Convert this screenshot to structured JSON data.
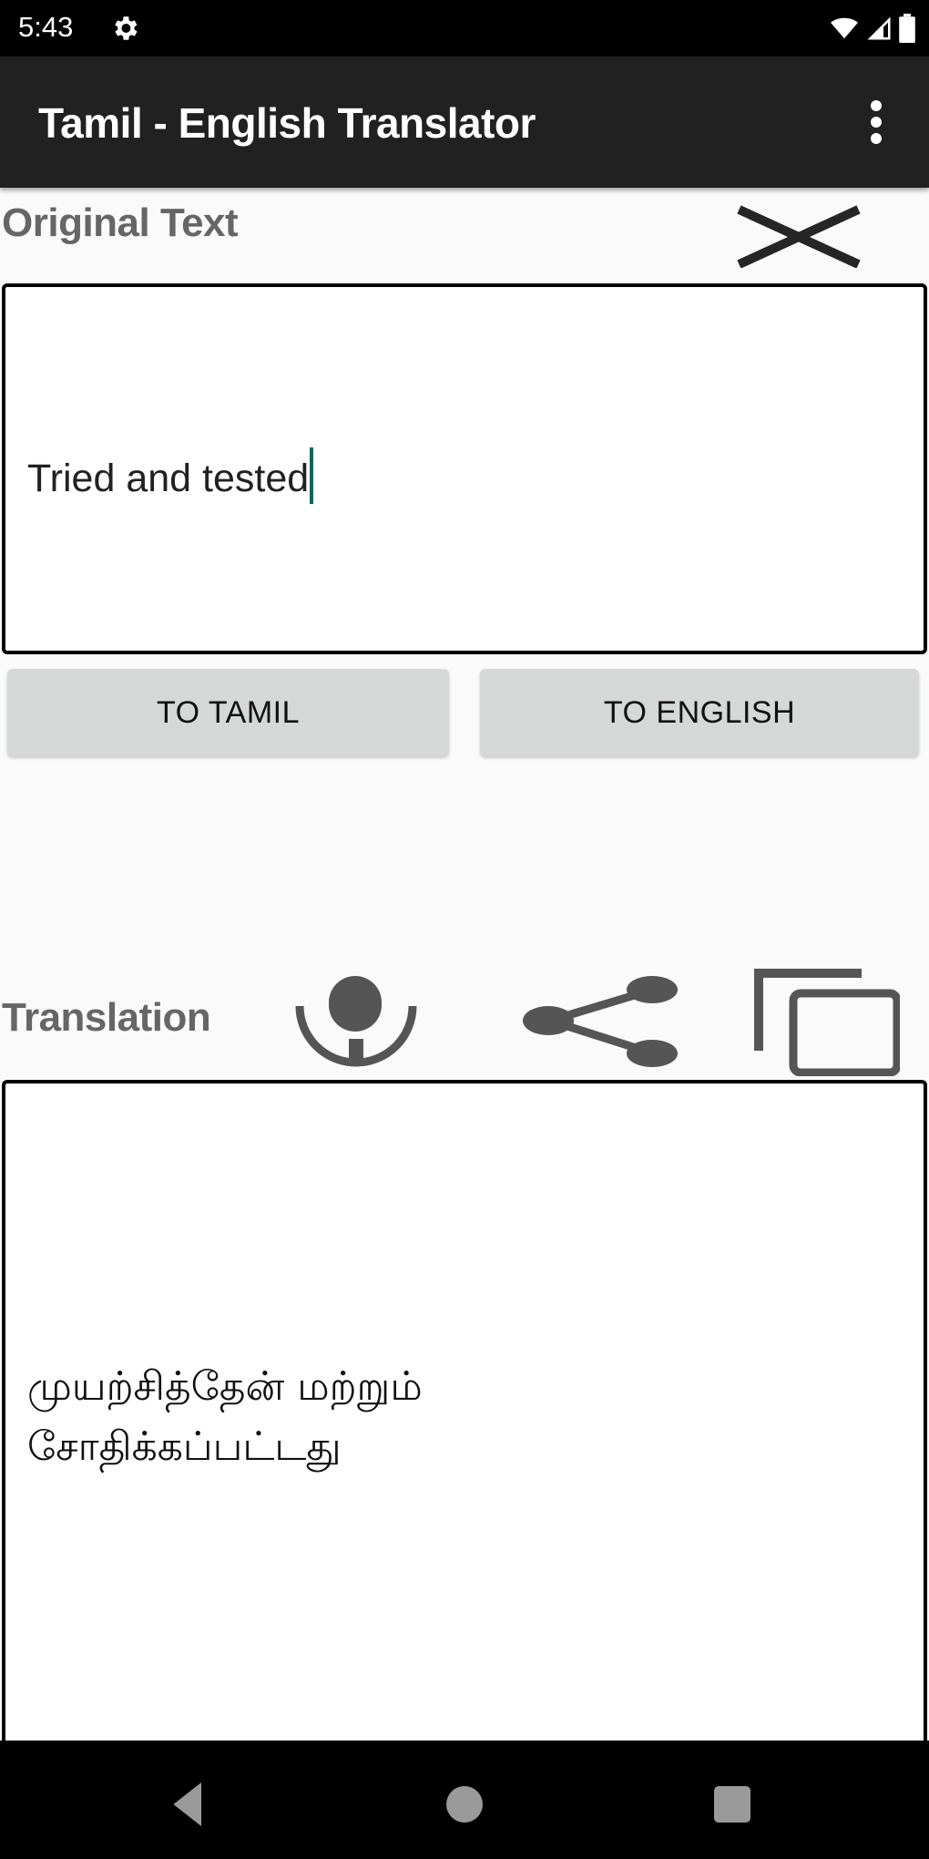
{
  "status_bar": {
    "time": "5:43",
    "icons": [
      "settings-icon",
      "wifi-icon",
      "signal-icon",
      "battery-icon"
    ]
  },
  "toolbar": {
    "title": "Tamil - English Translator",
    "overflow_icon": "more-vert-icon"
  },
  "original": {
    "label": "Original Text",
    "clear_icon": "close-icon",
    "input_value": "Tried and tested",
    "cursor_color": "#00695c"
  },
  "actions": {
    "to_tamil_label": "TO TAMIL",
    "to_english_label": "TO ENGLISH"
  },
  "translation": {
    "label": "Translation",
    "icons": [
      "microphone-icon",
      "share-icon",
      "copy-icon"
    ],
    "output_line1": "முயற்சித்தேன் மற்றும்",
    "output_line2": "சோதிக்கப்பட்டது",
    "icon_color": "#555555"
  },
  "nav_bar": {
    "buttons": [
      "back",
      "home",
      "recents"
    ]
  }
}
